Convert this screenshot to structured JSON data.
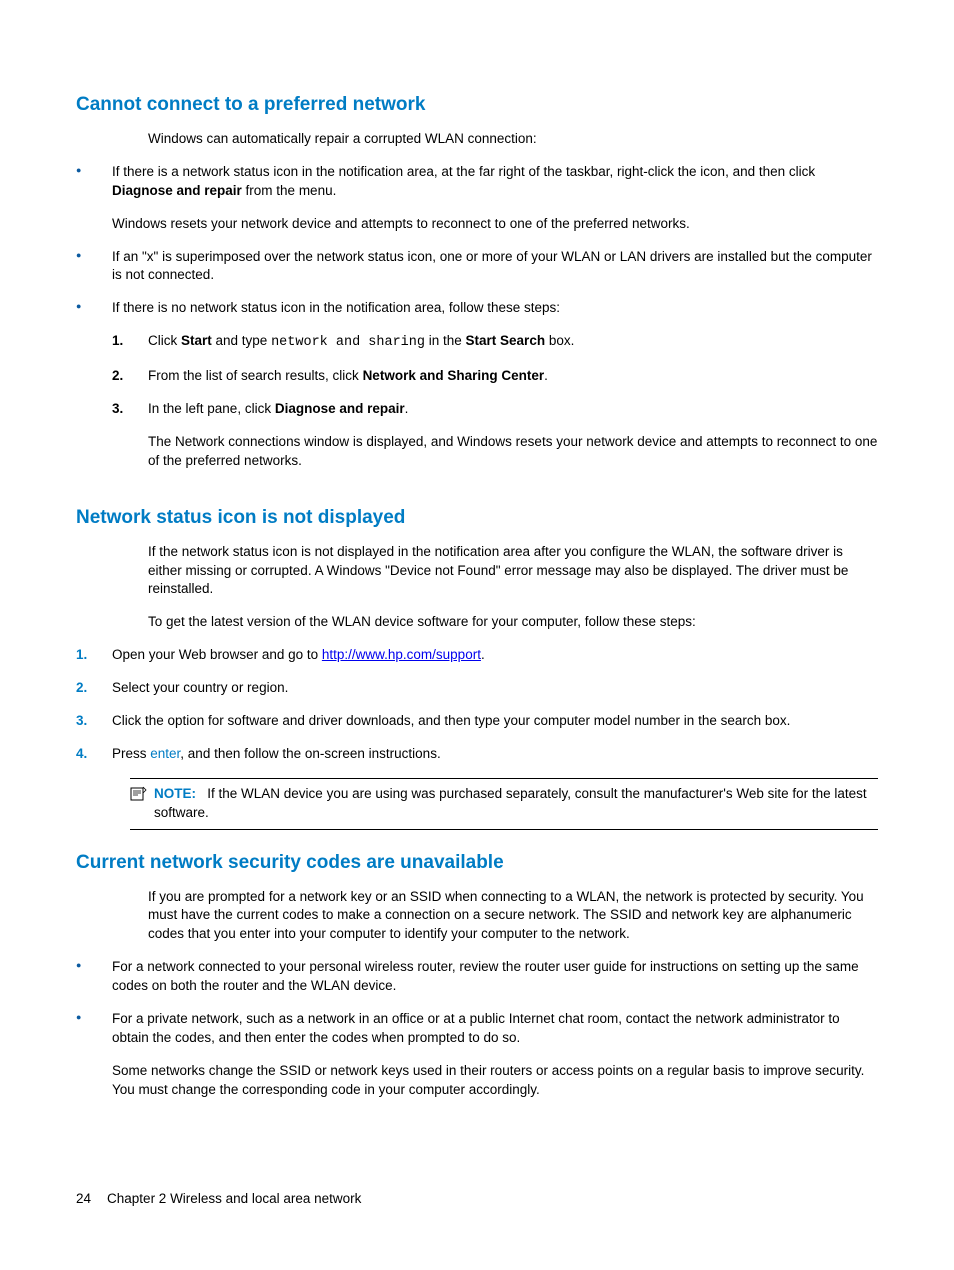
{
  "section1": {
    "heading": "Cannot connect to a preferred network",
    "intro": "Windows can automatically repair a corrupted WLAN connection:",
    "bullet1_pre": "If there is a network status icon in the notification area, at the far right of the taskbar, right-click the icon, and then click ",
    "bullet1_bold": "Diagnose and repair",
    "bullet1_post": " from the menu.",
    "bullet1_sub": "Windows resets your network device and attempts to reconnect to one of the preferred networks.",
    "bullet2": "If an \"x\" is superimposed over the network status icon, one or more of your WLAN or LAN drivers are installed but the computer is not connected.",
    "bullet3": "If there is no network status icon in the notification area, follow these steps:",
    "step1_n": "1.",
    "step1_a": "Click ",
    "step1_b": "Start",
    "step1_c": " and type ",
    "step1_d": "network and sharing",
    "step1_e": " in the ",
    "step1_f": "Start Search",
    "step1_g": " box.",
    "step2_n": "2.",
    "step2_a": "From the list of search results, click ",
    "step2_b": "Network and Sharing Center",
    "step2_c": ".",
    "step3_n": "3.",
    "step3_a": "In the left pane, click ",
    "step3_b": "Diagnose and repair",
    "step3_c": ".",
    "step3_sub": "The Network connections window is displayed, and Windows resets your network device and attempts to reconnect to one of the preferred networks."
  },
  "section2": {
    "heading": "Network status icon is not displayed",
    "p1": "If the network status icon is not displayed in the notification area after you configure the WLAN, the software driver is either missing or corrupted. A Windows \"Device not Found\" error message may also be displayed. The driver must be reinstalled.",
    "p2": "To get the latest version of the WLAN device software for your computer, follow these steps:",
    "s1_n": "1.",
    "s1_a": "Open your Web browser and go to ",
    "s1_link": "http://www.hp.com/support",
    "s1_b": ".",
    "s2_n": "2.",
    "s2": "Select your country or region.",
    "s3_n": "3.",
    "s3": "Click the option for software and driver downloads, and then type your computer model number in the search box.",
    "s4_n": "4.",
    "s4_a": "Press ",
    "s4_key": "enter",
    "s4_b": ", and then follow the on-screen instructions.",
    "note_label": "NOTE:",
    "note_text": "If the WLAN device you are using was purchased separately, consult the manufacturer's Web site for the latest software."
  },
  "section3": {
    "heading": "Current network security codes are unavailable",
    "p1": "If you are prompted for a network key or an SSID when connecting to a WLAN, the network is protected by security. You must have the current codes to make a connection on a secure network. The SSID and network key are alphanumeric codes that you enter into your computer to identify your computer to the network.",
    "b1": "For a network connected to your personal wireless router, review the router user guide for instructions on setting up the same codes on both the router and the WLAN device.",
    "b2": "For a private network, such as a network in an office or at a public Internet chat room, contact the network administrator to obtain the codes, and then enter the codes when prompted to do so.",
    "b2_sub": "Some networks change the SSID or network keys used in their routers or access points on a regular basis to improve security. You must change the corresponding code in your computer accordingly."
  },
  "footer": {
    "page": "24",
    "chapter": "Chapter 2   Wireless and local area network"
  }
}
